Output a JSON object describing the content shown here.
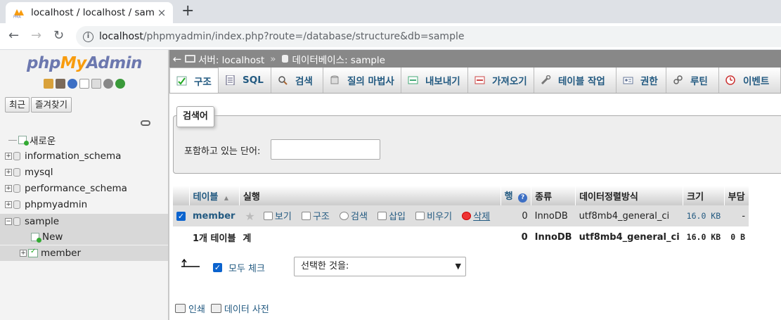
{
  "browser": {
    "tab_title": "localhost / localhost / sam",
    "tab_close": "×",
    "new_tab": "+",
    "url_host": "localhost",
    "url_path": "/phpmyadmin/index.php?route=/database/structure&db=sample",
    "back": "←",
    "forward": "→",
    "reload": "↻",
    "info": "i"
  },
  "sidebar": {
    "logo": {
      "php": "php",
      "my": "My",
      "admin": "Admin"
    },
    "recent_button": "최근",
    "favorites_button": "즐겨찾기",
    "tree": [
      {
        "label": "새로운",
        "kind": "new"
      },
      {
        "label": "information_schema",
        "kind": "db"
      },
      {
        "label": "mysql",
        "kind": "db"
      },
      {
        "label": "performance_schema",
        "kind": "db"
      },
      {
        "label": "phpmyadmin",
        "kind": "db"
      },
      {
        "label": "sample",
        "kind": "db",
        "selected": true
      },
      {
        "label": "New",
        "kind": "new-child"
      },
      {
        "label": "member",
        "kind": "table-child"
      }
    ],
    "expander_plus": "+",
    "expander_minus": "−"
  },
  "breadcrumb": {
    "back": "←",
    "server": "서버: localhost",
    "separator": "»",
    "database": "데이터베이스: sample"
  },
  "tabs": [
    {
      "label": "구조",
      "icon": "structure-icon",
      "active": true
    },
    {
      "label": "SQL",
      "icon": "sql-icon"
    },
    {
      "label": "검색",
      "icon": "search-icon"
    },
    {
      "label": "질의 마법사",
      "icon": "query-icon"
    },
    {
      "label": "내보내기",
      "icon": "export-icon"
    },
    {
      "label": "가져오기",
      "icon": "import-icon"
    },
    {
      "label": "테이블 작업",
      "icon": "wrench-icon"
    },
    {
      "label": "권한",
      "icon": "privileges-icon"
    },
    {
      "label": "루틴",
      "icon": "routines-icon"
    },
    {
      "label": "이벤트",
      "icon": "events-icon"
    }
  ],
  "filter": {
    "legend": "검색어",
    "label": "포함하고 있는 단어:",
    "value": ""
  },
  "table": {
    "headers": {
      "table": "테이블",
      "sort": "▲",
      "action": "실행",
      "rows": "행",
      "rows_help": "?",
      "type": "종류",
      "collation": "데이터정렬방식",
      "size": "크기",
      "overhead": "부담"
    },
    "rows": [
      {
        "name": "member",
        "checked": true,
        "actions": {
          "browse": "보기",
          "structure": "구조",
          "search": "검색",
          "insert": "삽입",
          "empty": "비우기",
          "drop": "삭제"
        },
        "row_count": "0",
        "engine": "InnoDB",
        "collation": "utf8mb4_general_ci",
        "size": "16.0 KB",
        "overhead": "-"
      }
    ],
    "footer": {
      "label": "1개 테이블",
      "sum": "계",
      "row_count": "0",
      "engine": "InnoDB",
      "collation": "utf8mb4_general_ci",
      "size": "16.0 KB",
      "overhead": "0 B"
    }
  },
  "bulk": {
    "check_all": "모두 체크",
    "with_selected": "선택한 것을:"
  },
  "bottom_links": {
    "print": "인쇄",
    "dictionary": "데이터 사전"
  },
  "colors": {
    "link": "#235a81",
    "breadcrumb_bg": "#888888",
    "selected_row": "#d8d8d8",
    "checkbox": "#0b63ce"
  }
}
